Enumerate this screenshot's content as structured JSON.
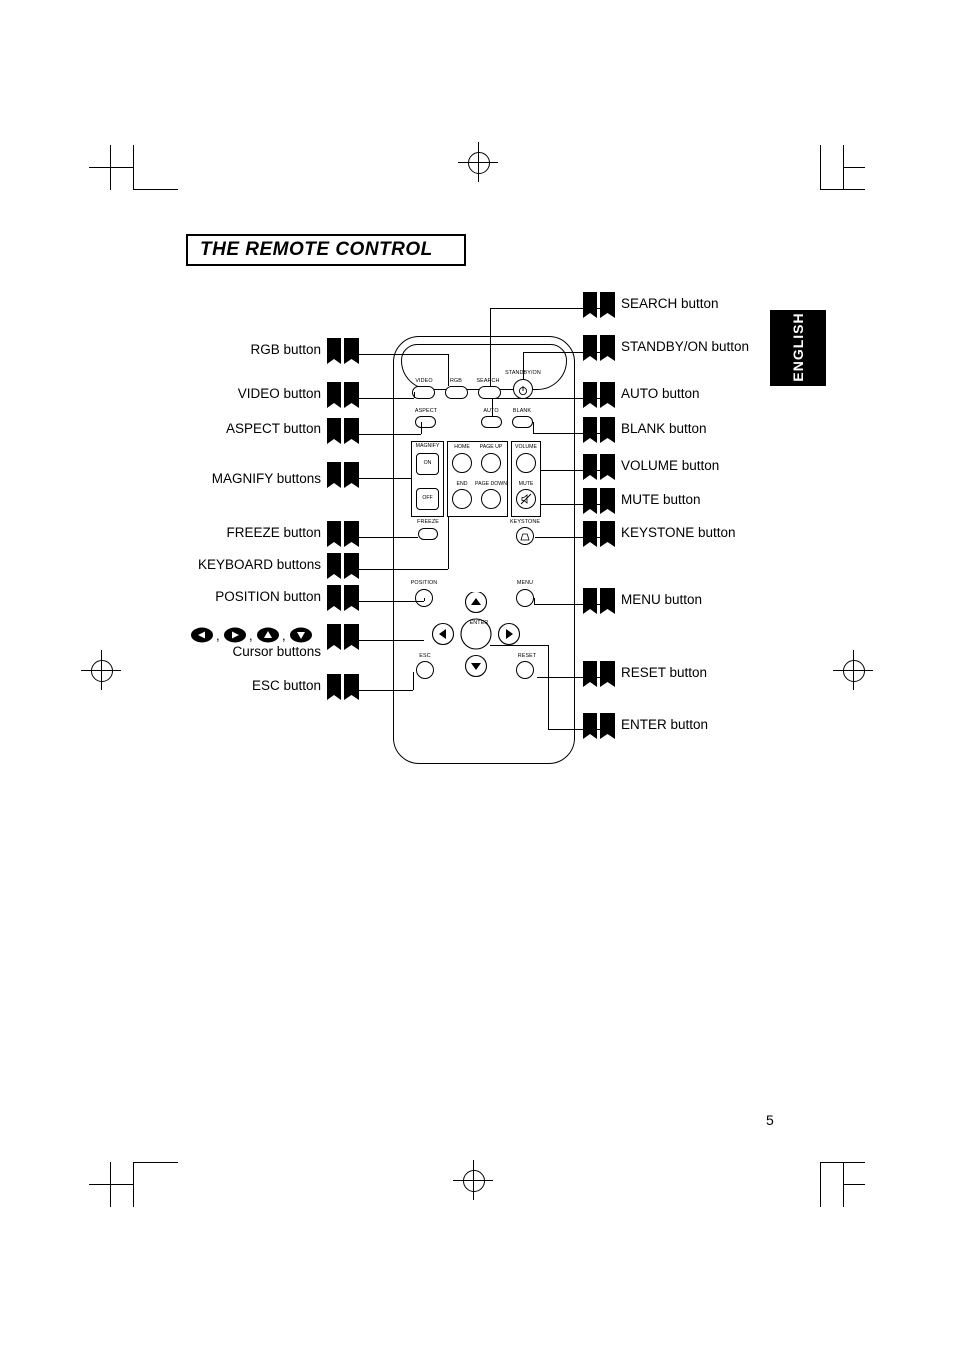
{
  "page": {
    "title": "THE REMOTE CONTROL",
    "sidebar_tab": "ENGLISH",
    "page_number": "5"
  },
  "callouts_left": [
    {
      "label": "RGB button"
    },
    {
      "label": "VIDEO button"
    },
    {
      "label": "ASPECT button"
    },
    {
      "label": "MAGNIFY buttons"
    },
    {
      "label": "FREEZE button"
    },
    {
      "label": "KEYBOARD buttons"
    },
    {
      "label": "POSITION button"
    },
    {
      "label": "Cursor buttons"
    },
    {
      "label": "ESC button"
    }
  ],
  "cursor_symbols": ", , ,",
  "callouts_right": [
    {
      "label": "SEARCH button"
    },
    {
      "label": "STANDBY/ON button"
    },
    {
      "label": "AUTO button"
    },
    {
      "label": "BLANK button"
    },
    {
      "label": "VOLUME button"
    },
    {
      "label": "MUTE button"
    },
    {
      "label": "KEYSTONE button"
    },
    {
      "label": "MENU button"
    },
    {
      "label": "RESET button"
    },
    {
      "label": "ENTER button"
    }
  ],
  "remote": {
    "keys": {
      "video": "VIDEO",
      "rgb": "RGB",
      "search": "SEARCH",
      "standby_on": "STANDBY/ON",
      "aspect": "ASPECT",
      "auto": "AUTO",
      "blank": "BLANK",
      "magnify": "MAGNIFY",
      "magnify_on": "ON",
      "magnify_off": "OFF",
      "home": "HOME",
      "page_up": "PAGE UP",
      "end": "END",
      "page_down": "PAGE DOWN",
      "volume": "VOLUME",
      "mute": "MUTE",
      "freeze": "FREEZE",
      "keystone": "KEYSTONE",
      "position": "POSITION",
      "menu": "MENU",
      "enter": "ENTER",
      "esc": "ESC",
      "reset": "RESET"
    }
  }
}
